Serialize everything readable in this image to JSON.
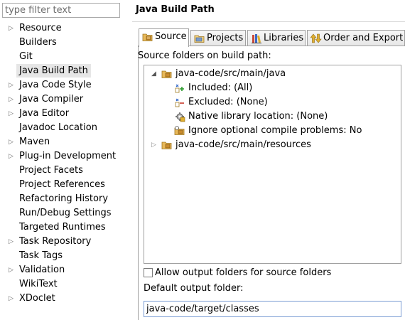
{
  "filter": {
    "placeholder": "type filter text"
  },
  "sidebar": {
    "items": [
      {
        "label": "Resource",
        "expandable": true
      },
      {
        "label": "Builders",
        "expandable": false
      },
      {
        "label": "Git",
        "expandable": false
      },
      {
        "label": "Java Build Path",
        "expandable": false,
        "selected": true
      },
      {
        "label": "Java Code Style",
        "expandable": true
      },
      {
        "label": "Java Compiler",
        "expandable": true
      },
      {
        "label": "Java Editor",
        "expandable": true
      },
      {
        "label": "Javadoc Location",
        "expandable": false
      },
      {
        "label": "Maven",
        "expandable": true
      },
      {
        "label": "Plug-in Development",
        "expandable": true
      },
      {
        "label": "Project Facets",
        "expandable": false
      },
      {
        "label": "Project References",
        "expandable": false
      },
      {
        "label": "Refactoring History",
        "expandable": false
      },
      {
        "label": "Run/Debug Settings",
        "expandable": false
      },
      {
        "label": "Targeted Runtimes",
        "expandable": false
      },
      {
        "label": "Task Repository",
        "expandable": true
      },
      {
        "label": "Task Tags",
        "expandable": false
      },
      {
        "label": "Validation",
        "expandable": true
      },
      {
        "label": "WikiText",
        "expandable": false
      },
      {
        "label": "XDoclet",
        "expandable": true
      }
    ]
  },
  "page": {
    "title": "Java Build Path"
  },
  "tabs": [
    {
      "label": "Source",
      "icon": "source-folder-icon",
      "active": true
    },
    {
      "label": "Projects",
      "icon": "projects-icon",
      "active": false
    },
    {
      "label": "Libraries",
      "icon": "libraries-icon",
      "active": false
    },
    {
      "label": "Order and Export",
      "icon": "order-export-icon",
      "active": false
    }
  ],
  "source": {
    "label": "Source folders on build path:",
    "folders": [
      {
        "name": "java-code/src/main/java",
        "expanded": true,
        "children": [
          {
            "label": "Included: (All)",
            "icon": "included-icon"
          },
          {
            "label": "Excluded: (None)",
            "icon": "excluded-icon"
          },
          {
            "label": "Native library location: (None)",
            "icon": "native-library-icon"
          },
          {
            "label": "Ignore optional compile problems: No",
            "icon": "ignore-problems-icon"
          }
        ]
      },
      {
        "name": "java-code/src/main/resources",
        "expanded": false,
        "children": []
      }
    ],
    "allow_output_label": "Allow output folders for source folders",
    "allow_output_checked": false,
    "default_output_label": "Default output folder:",
    "default_output_value": "java-code/target/classes"
  }
}
